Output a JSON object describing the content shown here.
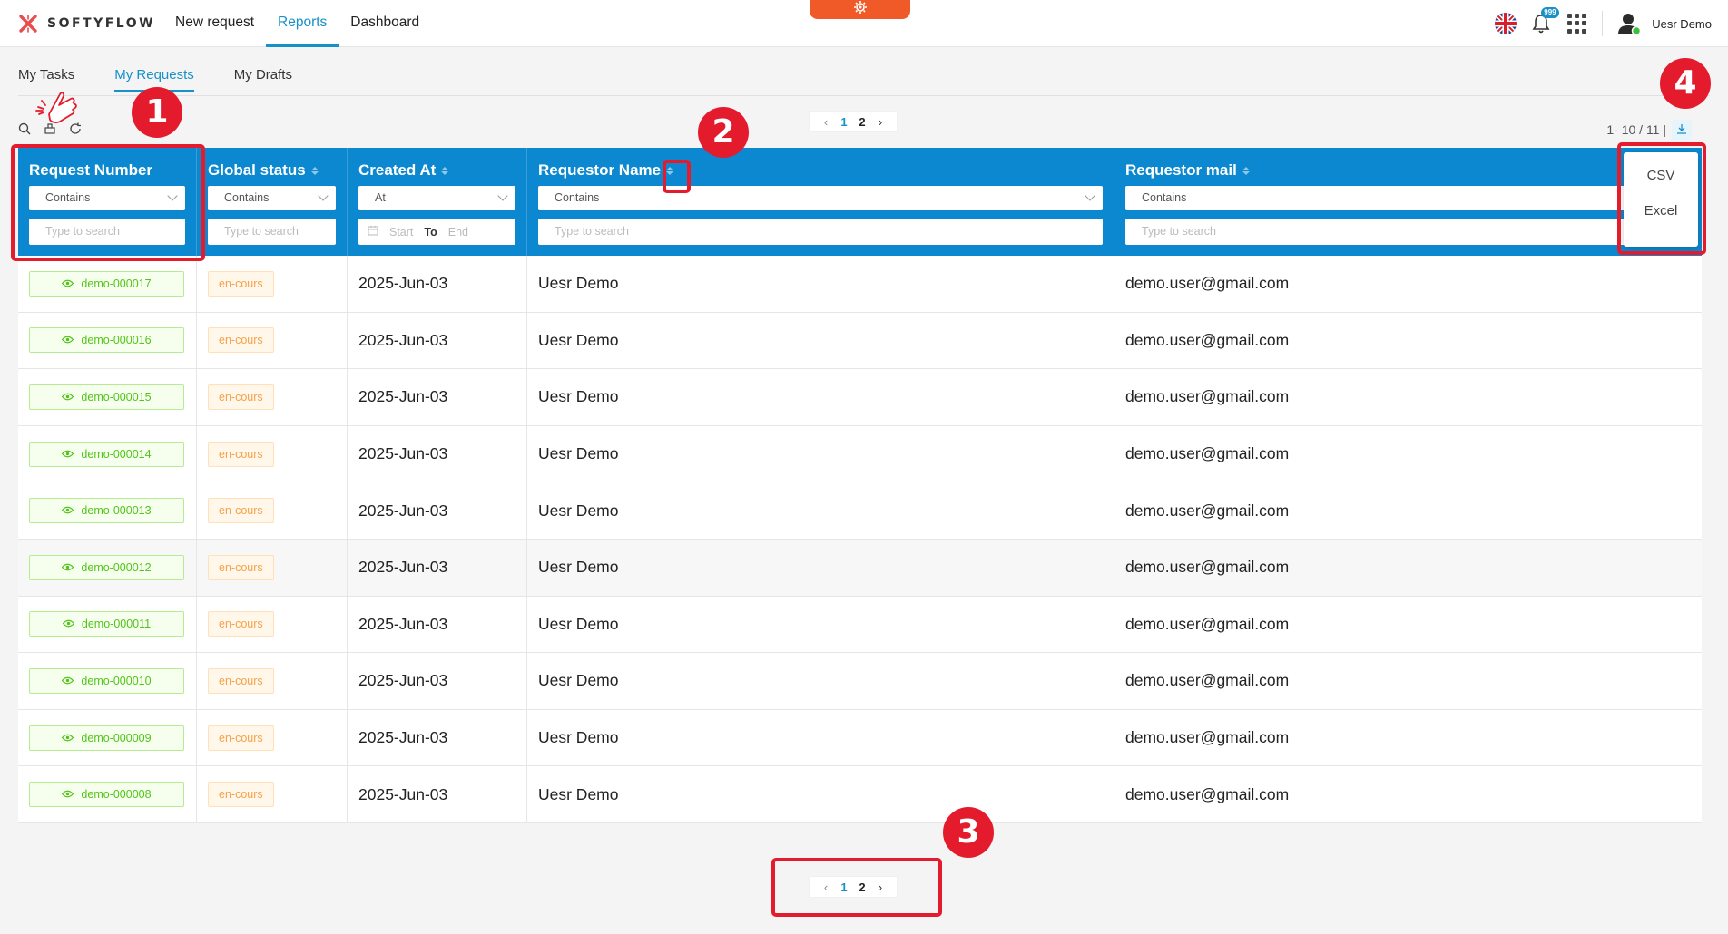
{
  "app": {
    "brand": "SOFTYFLOW"
  },
  "nav": {
    "items": [
      {
        "label": "New request"
      },
      {
        "label": "Reports"
      },
      {
        "label": "Dashboard"
      }
    ]
  },
  "header": {
    "notification_count": "999",
    "user_name": "Uesr Demo"
  },
  "subtabs": {
    "items": [
      {
        "label": "My Tasks"
      },
      {
        "label": "My Requests"
      },
      {
        "label": "My Drafts"
      }
    ]
  },
  "pagination": {
    "pages": [
      "1",
      "2"
    ],
    "current": "1",
    "range_text": "1- 10 / 11 |"
  },
  "export": {
    "options": [
      "CSV",
      "Excel"
    ]
  },
  "table": {
    "columns": [
      {
        "title": "Request Number",
        "filter_op": "Contains",
        "placeholder": "Type to search"
      },
      {
        "title": "Global status",
        "filter_op": "Contains",
        "placeholder": "Type to search"
      },
      {
        "title": "Created At",
        "filter_op": "At",
        "range_start": "Start",
        "range_to": "To",
        "range_end": "End"
      },
      {
        "title": "Requestor Name",
        "filter_op": "Contains",
        "placeholder": "Type to search"
      },
      {
        "title": "Requestor mail",
        "filter_op": "Contains",
        "placeholder": "Type to search"
      }
    ],
    "rows": [
      {
        "id": "demo-000017",
        "status": "en-cours",
        "created": "2025-Jun-03",
        "name": "Uesr Demo",
        "mail": "demo.user@gmail.com"
      },
      {
        "id": "demo-000016",
        "status": "en-cours",
        "created": "2025-Jun-03",
        "name": "Uesr Demo",
        "mail": "demo.user@gmail.com"
      },
      {
        "id": "demo-000015",
        "status": "en-cours",
        "created": "2025-Jun-03",
        "name": "Uesr Demo",
        "mail": "demo.user@gmail.com"
      },
      {
        "id": "demo-000014",
        "status": "en-cours",
        "created": "2025-Jun-03",
        "name": "Uesr Demo",
        "mail": "demo.user@gmail.com"
      },
      {
        "id": "demo-000013",
        "status": "en-cours",
        "created": "2025-Jun-03",
        "name": "Uesr Demo",
        "mail": "demo.user@gmail.com"
      },
      {
        "id": "demo-000012",
        "status": "en-cours",
        "created": "2025-Jun-03",
        "name": "Uesr Demo",
        "mail": "demo.user@gmail.com"
      },
      {
        "id": "demo-000011",
        "status": "en-cours",
        "created": "2025-Jun-03",
        "name": "Uesr Demo",
        "mail": "demo.user@gmail.com"
      },
      {
        "id": "demo-000010",
        "status": "en-cours",
        "created": "2025-Jun-03",
        "name": "Uesr Demo",
        "mail": "demo.user@gmail.com"
      },
      {
        "id": "demo-000009",
        "status": "en-cours",
        "created": "2025-Jun-03",
        "name": "Uesr Demo",
        "mail": "demo.user@gmail.com"
      },
      {
        "id": "demo-000008",
        "status": "en-cours",
        "created": "2025-Jun-03",
        "name": "Uesr Demo",
        "mail": "demo.user@gmail.com"
      }
    ]
  },
  "annotations": {
    "labels": [
      "1",
      "2",
      "3",
      "4"
    ]
  },
  "colors": {
    "primary": "#0b88cf",
    "accent": "#f05a28",
    "highlight": "#e31b2d",
    "success": "#52c41a",
    "warning": "#f5a24a"
  },
  "icons": {
    "logo": "softyflow-logo-icon",
    "settings": "gear-icon",
    "language": "uk-flag-icon",
    "notifications": "bell-icon",
    "apps": "apps-grid-icon",
    "user": "user-avatar-icon",
    "search": "search-icon",
    "clear": "clear-filter-icon",
    "refresh": "refresh-icon",
    "download": "download-icon",
    "view": "eye-icon",
    "calendar": "calendar-icon",
    "pointer": "hand-pointer-icon"
  }
}
